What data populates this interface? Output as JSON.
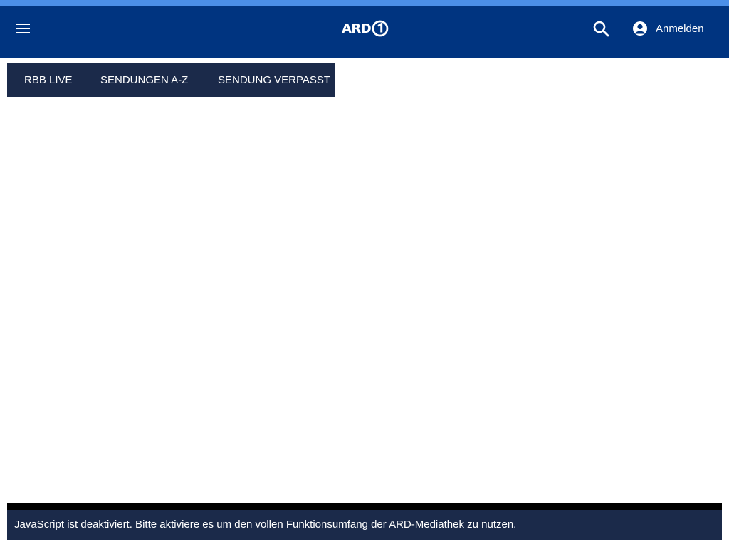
{
  "colors": {
    "accent_strip": "#4b8fe8",
    "header_bg": "#003480",
    "subnav_bg": "#1b2a4a",
    "notice_bg": "#1b2a4a",
    "text_light": "#ffffff"
  },
  "header": {
    "menu_icon": "hamburger-menu-icon",
    "logo_text": "ARD",
    "logo_badge_icon": "ard-one-badge-icon",
    "search_icon": "search-icon",
    "user_icon": "user-avatar-icon",
    "login_label": "Anmelden"
  },
  "subnav": {
    "items": [
      {
        "label": "RBB LIVE"
      },
      {
        "label": "SENDUNGEN A-Z"
      },
      {
        "label": "SENDUNG VERPASST"
      }
    ]
  },
  "notice": {
    "text": "JavaScript ist deaktiviert. Bitte aktiviere es um den vollen Funktionsumfang der ARD-Mediathek zu nutzen."
  }
}
